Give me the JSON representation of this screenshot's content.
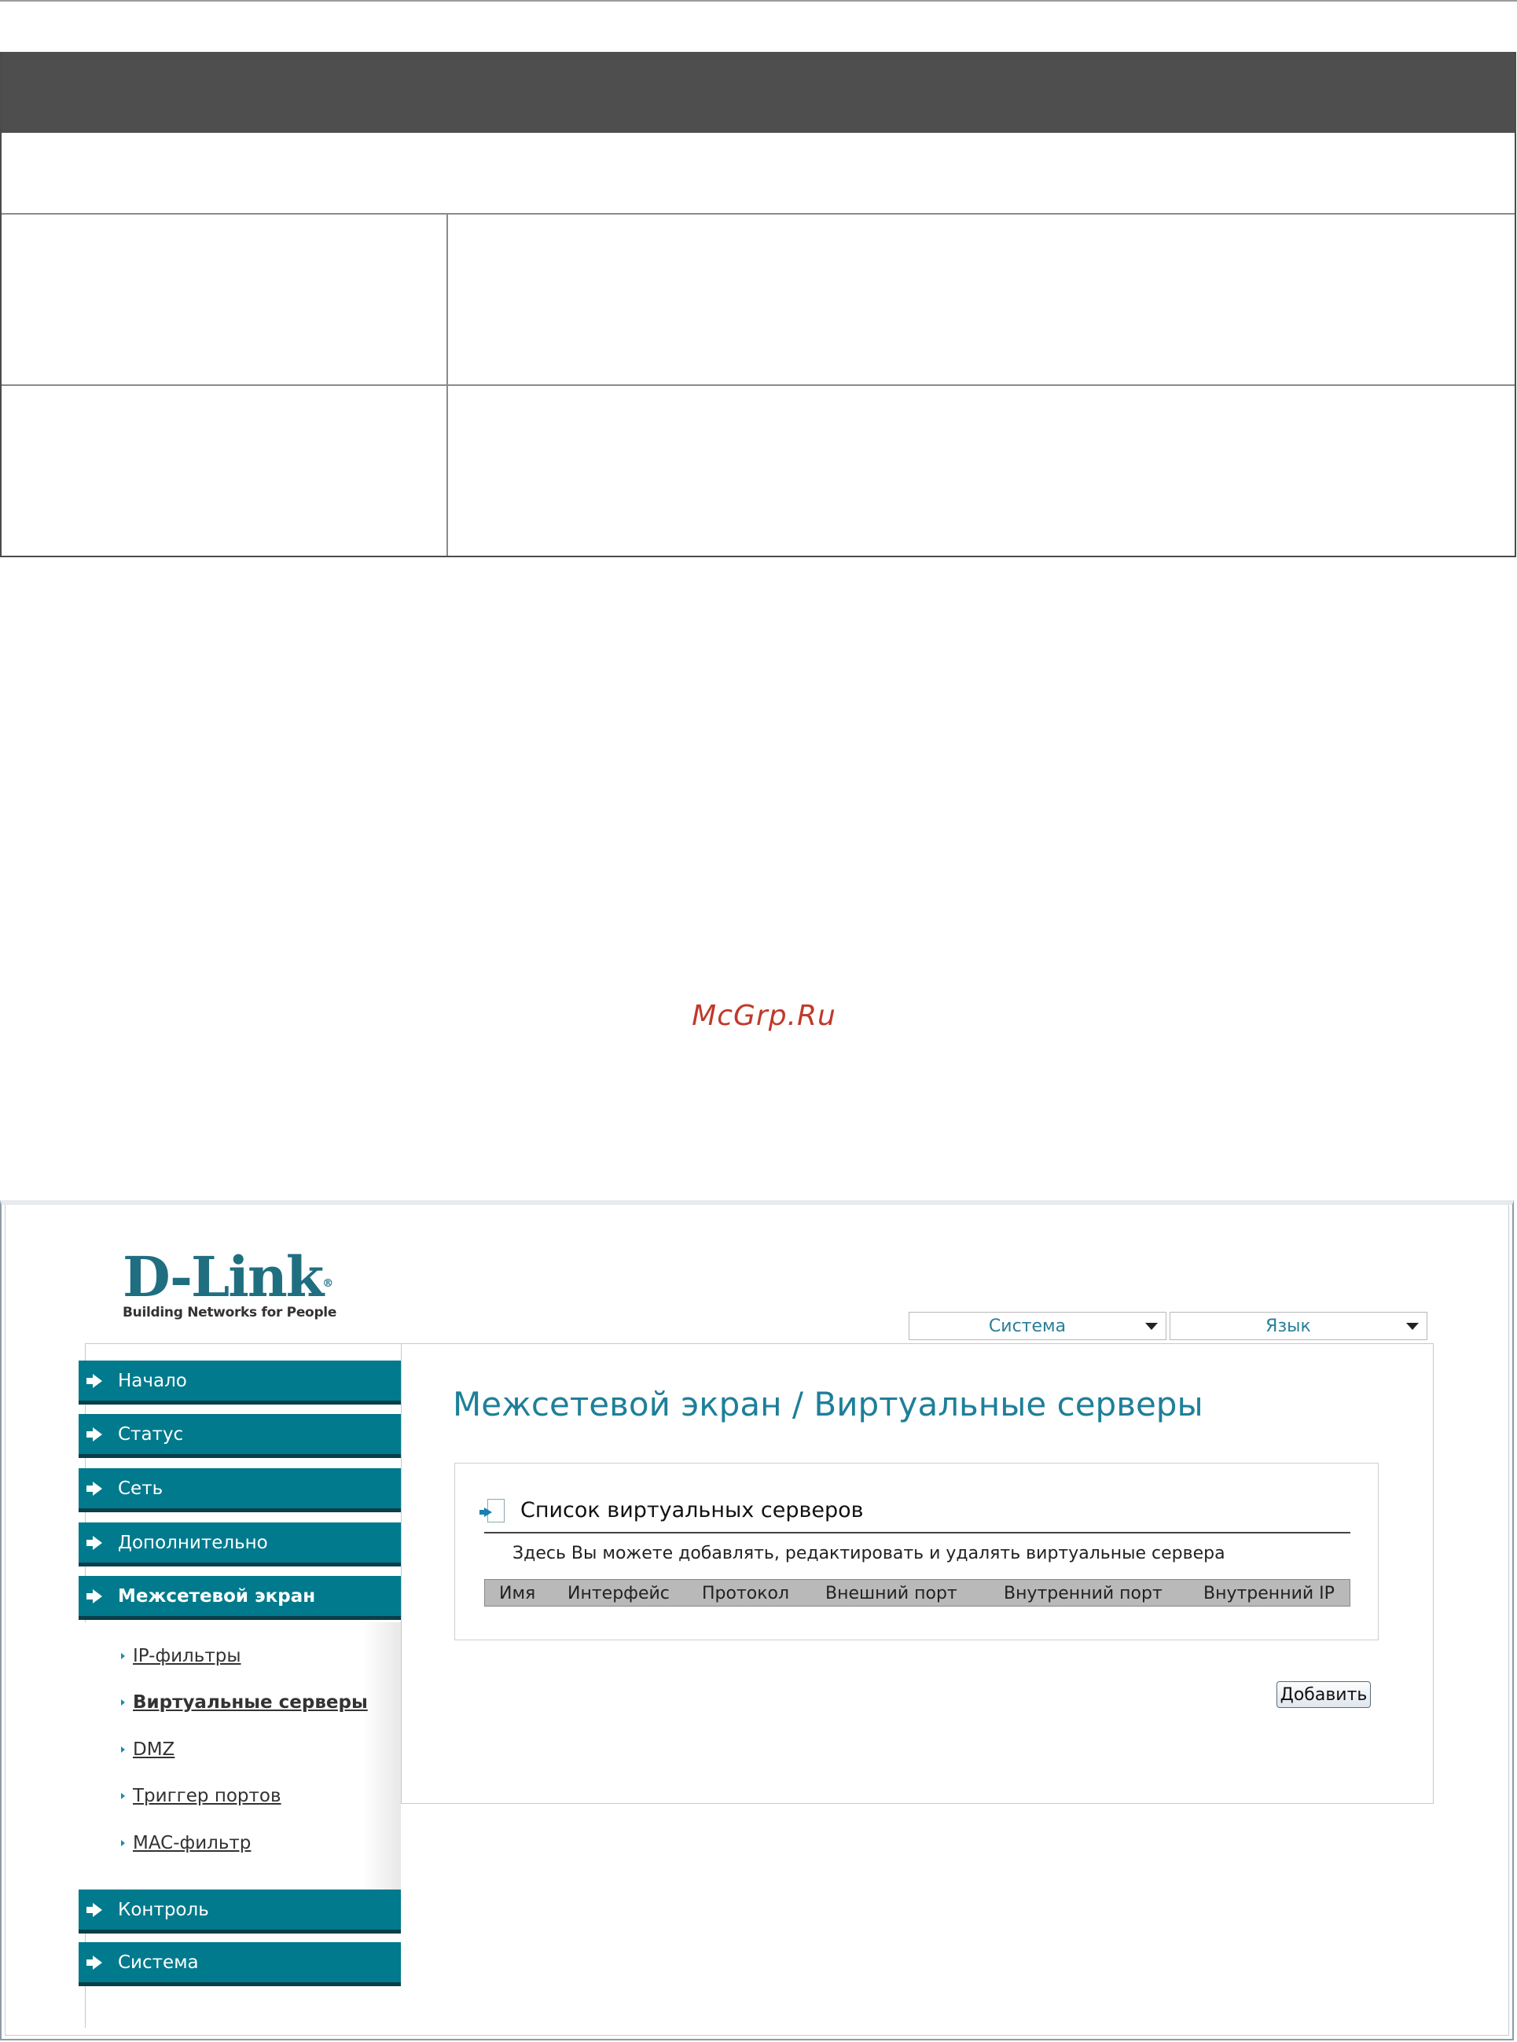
{
  "watermark": "McGrp.Ru",
  "app": {
    "logo": {
      "brand": "D-Link",
      "registered": "®",
      "tagline": "Building Networks for People"
    },
    "top_selects": [
      {
        "label": "Система"
      },
      {
        "label": "Язык"
      }
    ],
    "nav": {
      "items": [
        {
          "label": "Начало"
        },
        {
          "label": "Статус"
        },
        {
          "label": "Сеть"
        },
        {
          "label": "Дополнительно"
        },
        {
          "label": "Межсетевой экран",
          "active": true
        },
        {
          "label": "Контроль"
        },
        {
          "label": "Система"
        }
      ],
      "sub_items": [
        {
          "label": "IP-фильтры"
        },
        {
          "label": "Виртуальные серверы",
          "active": true
        },
        {
          "label": "DMZ"
        },
        {
          "label": "Триггер портов"
        },
        {
          "label": "MAC-фильтр"
        }
      ]
    },
    "main": {
      "title": "Межсетевой экран /  Виртуальные серверы",
      "section": {
        "title": "Список виртуальных серверов",
        "description": "Здесь Вы можете добавлять, редактировать и удалять виртуальные сервера",
        "columns": [
          "Имя",
          "Интерфейс",
          "Протокол",
          "Внешний порт",
          "Внутренний порт",
          "Внутренний IP"
        ],
        "rows": []
      },
      "add_button": "Добавить"
    },
    "colors": {
      "accent": "#007a8c",
      "title": "#1e7f99",
      "header_bar": "#4e4e4e"
    }
  }
}
